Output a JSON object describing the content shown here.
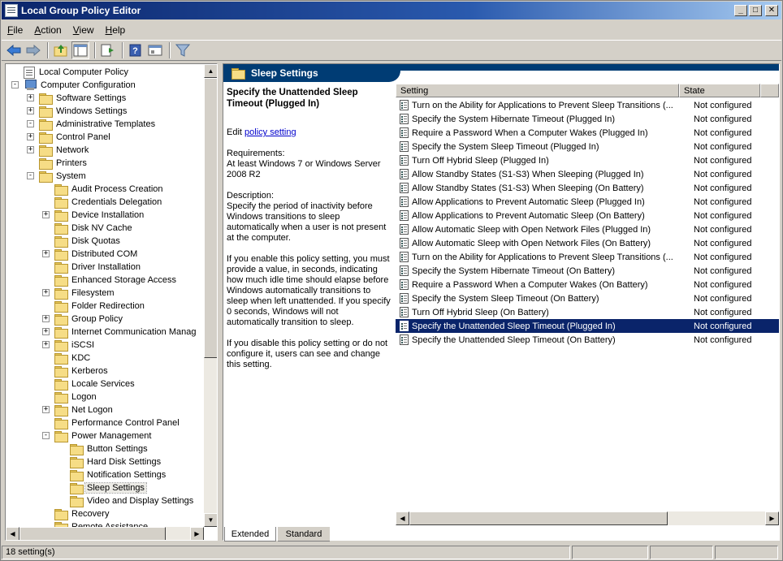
{
  "window": {
    "title": "Local Group Policy Editor"
  },
  "menu": [
    {
      "label": "File",
      "key": "F",
      "rest": "ile"
    },
    {
      "label": "Action",
      "key": "A",
      "rest": "ction"
    },
    {
      "label": "View",
      "key": "V",
      "rest": "iew"
    },
    {
      "label": "Help",
      "key": "H",
      "rest": "elp"
    }
  ],
  "toolbar": {
    "icons": [
      "back-arrow-icon",
      "forward-arrow-icon",
      "up-folder-icon",
      "show-hide-tree-icon",
      "export-list-icon",
      "help-icon",
      "properties-icon",
      "filter-icon"
    ]
  },
  "tree": [
    {
      "label": "Local Computer Policy",
      "icon": "doc",
      "level": 0,
      "expander": ""
    },
    {
      "label": "Computer Configuration",
      "icon": "pc",
      "level": 1,
      "expander": "-"
    },
    {
      "label": "Software Settings",
      "icon": "folder",
      "level": 2,
      "expander": "+"
    },
    {
      "label": "Windows Settings",
      "icon": "folder",
      "level": 2,
      "expander": "+"
    },
    {
      "label": "Administrative Templates",
      "icon": "folder",
      "level": 2,
      "expander": "-"
    },
    {
      "label": "Control Panel",
      "icon": "folder",
      "level": 3,
      "expander": "+"
    },
    {
      "label": "Network",
      "icon": "folder",
      "level": 3,
      "expander": "+"
    },
    {
      "label": "Printers",
      "icon": "folder",
      "level": 3,
      "expander": ""
    },
    {
      "label": "System",
      "icon": "folder",
      "level": 3,
      "expander": "-"
    },
    {
      "label": "Audit Process Creation",
      "icon": "folder",
      "level": 4,
      "expander": ""
    },
    {
      "label": "Credentials Delegation",
      "icon": "folder",
      "level": 4,
      "expander": ""
    },
    {
      "label": "Device Installation",
      "icon": "folder",
      "level": 4,
      "expander": "+"
    },
    {
      "label": "Disk NV Cache",
      "icon": "folder",
      "level": 4,
      "expander": ""
    },
    {
      "label": "Disk Quotas",
      "icon": "folder",
      "level": 4,
      "expander": ""
    },
    {
      "label": "Distributed COM",
      "icon": "folder",
      "level": 4,
      "expander": "+"
    },
    {
      "label": "Driver Installation",
      "icon": "folder",
      "level": 4,
      "expander": ""
    },
    {
      "label": "Enhanced Storage Access",
      "icon": "folder",
      "level": 4,
      "expander": ""
    },
    {
      "label": "Filesystem",
      "icon": "folder",
      "level": 4,
      "expander": "+"
    },
    {
      "label": "Folder Redirection",
      "icon": "folder",
      "level": 4,
      "expander": ""
    },
    {
      "label": "Group Policy",
      "icon": "folder",
      "level": 4,
      "expander": "+"
    },
    {
      "label": "Internet Communication Manag",
      "icon": "folder",
      "level": 4,
      "expander": "+"
    },
    {
      "label": "iSCSI",
      "icon": "folder",
      "level": 4,
      "expander": "+"
    },
    {
      "label": "KDC",
      "icon": "folder",
      "level": 4,
      "expander": ""
    },
    {
      "label": "Kerberos",
      "icon": "folder",
      "level": 4,
      "expander": ""
    },
    {
      "label": "Locale Services",
      "icon": "folder",
      "level": 4,
      "expander": ""
    },
    {
      "label": "Logon",
      "icon": "folder",
      "level": 4,
      "expander": ""
    },
    {
      "label": "Net Logon",
      "icon": "folder",
      "level": 4,
      "expander": "+"
    },
    {
      "label": "Performance Control Panel",
      "icon": "folder",
      "level": 4,
      "expander": ""
    },
    {
      "label": "Power Management",
      "icon": "folder",
      "level": 4,
      "expander": "-"
    },
    {
      "label": "Button Settings",
      "icon": "folder",
      "level": 5,
      "expander": ""
    },
    {
      "label": "Hard Disk Settings",
      "icon": "folder",
      "level": 5,
      "expander": ""
    },
    {
      "label": "Notification Settings",
      "icon": "folder",
      "level": 5,
      "expander": ""
    },
    {
      "label": "Sleep Settings",
      "icon": "folder",
      "level": 5,
      "expander": "",
      "selected": true
    },
    {
      "label": "Video and Display Settings",
      "icon": "folder",
      "level": 5,
      "expander": ""
    },
    {
      "label": "Recovery",
      "icon": "folder",
      "level": 4,
      "expander": ""
    },
    {
      "label": "Remote Assistance",
      "icon": "folder",
      "level": 4,
      "expander": ""
    }
  ],
  "header": {
    "title": "Sleep Settings"
  },
  "description": {
    "title": "Specify the Unattended Sleep Timeout (Plugged In)",
    "edit_prefix": "Edit ",
    "edit_link": "policy setting ",
    "requirements_label": "Requirements:",
    "requirements": "At least Windows 7 or Windows Server 2008 R2",
    "description_label": "Description:",
    "p1": "Specify the period of inactivity before Windows transitions to sleep automatically when a user is not present at the computer.",
    "p2": "If you enable this policy setting, you must provide a value, in seconds, indicating how much idle time should elapse before Windows automatically transitions to sleep when left unattended.  If you specify 0 seconds, Windows will not automatically transition to sleep.",
    "p3": "If you disable this policy setting or do not configure it, users can see and change this setting."
  },
  "columns": {
    "setting": "Setting",
    "state": "State"
  },
  "settings": [
    {
      "setting": "Turn on the Ability for Applications to Prevent Sleep Transitions (...",
      "state": "Not configured"
    },
    {
      "setting": "Specify the System Hibernate Timeout (Plugged In)",
      "state": "Not configured"
    },
    {
      "setting": "Require a Password When a Computer Wakes (Plugged In)",
      "state": "Not configured"
    },
    {
      "setting": "Specify the System Sleep Timeout (Plugged In)",
      "state": "Not configured"
    },
    {
      "setting": "Turn Off Hybrid Sleep (Plugged In)",
      "state": "Not configured"
    },
    {
      "setting": "Allow Standby States (S1-S3) When Sleeping (Plugged In)",
      "state": "Not configured"
    },
    {
      "setting": "Allow Standby States (S1-S3) When Sleeping (On Battery)",
      "state": "Not configured"
    },
    {
      "setting": "Allow Applications to Prevent Automatic Sleep (Plugged In)",
      "state": "Not configured"
    },
    {
      "setting": "Allow Applications to Prevent Automatic Sleep (On Battery)",
      "state": "Not configured"
    },
    {
      "setting": "Allow Automatic Sleep with Open Network Files (Plugged In)",
      "state": "Not configured"
    },
    {
      "setting": "Allow Automatic Sleep with Open Network Files (On Battery)",
      "state": "Not configured"
    },
    {
      "setting": "Turn on the Ability for Applications to Prevent Sleep Transitions (...",
      "state": "Not configured"
    },
    {
      "setting": "Specify the System Hibernate Timeout (On Battery)",
      "state": "Not configured"
    },
    {
      "setting": "Require a Password When a Computer Wakes (On Battery)",
      "state": "Not configured"
    },
    {
      "setting": "Specify the System Sleep Timeout (On Battery)",
      "state": "Not configured"
    },
    {
      "setting": "Turn Off Hybrid Sleep (On Battery)",
      "state": "Not configured"
    },
    {
      "setting": "Specify the Unattended Sleep Timeout (Plugged In)",
      "state": "Not configured",
      "selected": true
    },
    {
      "setting": "Specify the Unattended Sleep Timeout (On Battery)",
      "state": "Not configured"
    }
  ],
  "tabs": [
    {
      "label": "Extended",
      "active": true
    },
    {
      "label": "Standard",
      "active": false
    }
  ],
  "status": {
    "text": "18 setting(s)"
  },
  "colors": {
    "selection": "#0a246a",
    "header_band": "#003c74",
    "link": "#0000cc"
  }
}
